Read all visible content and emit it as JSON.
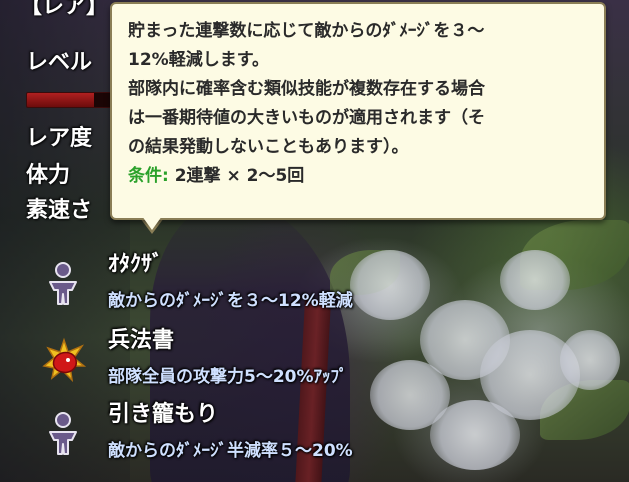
{
  "header": {
    "top_label": "【レア】"
  },
  "stats": {
    "level_label": "レベル",
    "level_bar_fill_pct": 56,
    "rarity_label": "レア度",
    "hp_label": "体力",
    "speed_label": "素速さ"
  },
  "tooltip": {
    "line1": "貯まった連撃数に応じて敵からのﾀﾞﾒｰｼﾞを３〜",
    "line2": "12%軽減します。",
    "line3": "部隊内に確率含む類似技能が複数存在する場合",
    "line4": "は一番期待値の大きいものが適用されます（そ",
    "line5": "の結果発動しないこともあります）。",
    "condition_label": "条件:",
    "condition_value": " 2連撃 × 2〜5回"
  },
  "skills": [
    {
      "name": "ｵﾀｸｻﾞ",
      "description": "敵からのﾀﾞﾒｰｼﾞを３〜12%軽減",
      "icon": "person-figure-icon"
    },
    {
      "name": "兵法書",
      "description": "部隊全員の攻撃力5〜20%ｱｯﾌﾟ",
      "icon": "red-burst-icon"
    },
    {
      "name": "引き籠もり",
      "description": "敵からのﾀﾞﾒｰｼﾞ半減率５〜20%",
      "icon": "person-figure-icon"
    }
  ],
  "colors": {
    "tooltip_bg": "#fdfbe4",
    "condition_green": "#2aa12a",
    "skill_desc_blue": "#cfe0ff",
    "level_bar_red": "#b02020"
  }
}
